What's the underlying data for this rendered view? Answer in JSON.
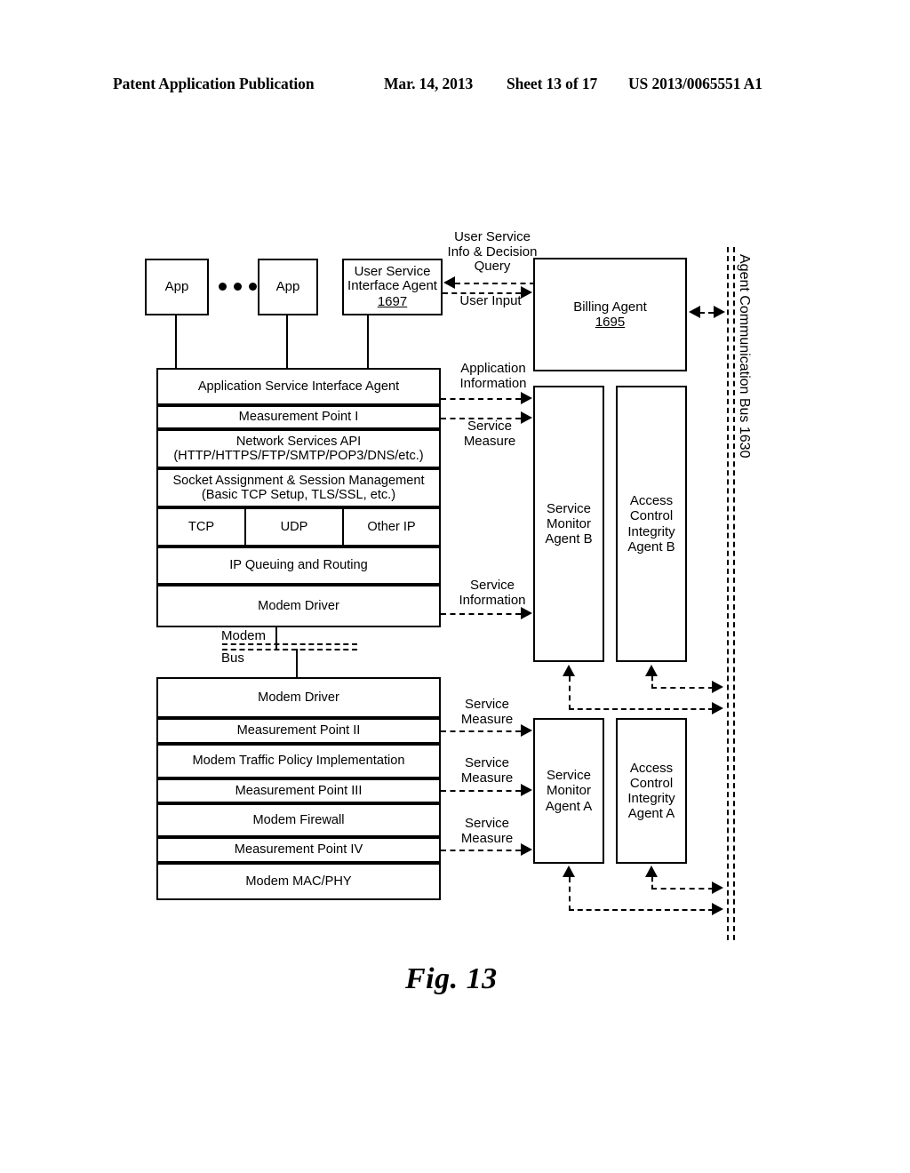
{
  "header": {
    "publication": "Patent Application Publication",
    "date": "Mar. 14, 2013",
    "sheet": "Sheet 13 of 17",
    "patent_number": "US 2013/0065551 A1"
  },
  "figure": {
    "caption": "Fig. 13"
  },
  "apps": {
    "app_left": "App",
    "app_right": "App",
    "ellipsis": "• • •"
  },
  "user_service_interface_agent": {
    "title": "User Service\nInterface Agent",
    "ref": "1697"
  },
  "billing_agent": {
    "title": "Billing Agent",
    "ref": "1695"
  },
  "device_stack_upper": {
    "rows": [
      {
        "label": "Application Service Interface Agent"
      },
      {
        "label": "Measurement Point I"
      },
      {
        "label": "Network Services API\n(HTTP/HTTPS/FTP/SMTP/POP3/DNS/etc.)"
      },
      {
        "label": "Socket Assignment & Session Management\n(Basic TCP Setup, TLS/SSL, etc.)"
      },
      {
        "label": "IP Queuing and Routing"
      },
      {
        "label": "Modem Driver"
      }
    ],
    "transport_row": [
      {
        "label": "TCP"
      },
      {
        "label": "UDP"
      },
      {
        "label": "Other IP"
      }
    ]
  },
  "modem_bus": {
    "label_line1": "Modem",
    "label_line2": "Bus"
  },
  "device_stack_lower": {
    "rows": [
      {
        "label": "Modem Driver"
      },
      {
        "label": "Measurement Point II"
      },
      {
        "label": "Modem Traffic Policy Implementation"
      },
      {
        "label": "Measurement Point III"
      },
      {
        "label": "Modem Firewall"
      },
      {
        "label": "Measurement Point IV"
      },
      {
        "label": "Modem MAC/PHY"
      }
    ]
  },
  "agents": {
    "service_monitor_b": "Service\nMonitor\nAgent B",
    "access_control_integrity_b": "Access\nControl\nIntegrity\nAgent B",
    "service_monitor_a": "Service\nMonitor\nAgent A",
    "access_control_integrity_a": "Access\nControl\nIntegrity\nAgent A"
  },
  "bus": {
    "label": "Agent Communication Bus 1630"
  },
  "flow_labels": {
    "user_service_info_decision_query": "User Service\nInfo & Decision\nQuery",
    "user_input": "User Input",
    "application_information": "Application\nInformation",
    "service_measure_upper": "Service\nMeasure",
    "service_information": "Service\nInformation",
    "service_measure_lower_1": "Service\nMeasure",
    "service_measure_lower_2": "Service\nMeasure",
    "service_measure_lower_3": "Service\nMeasure"
  }
}
